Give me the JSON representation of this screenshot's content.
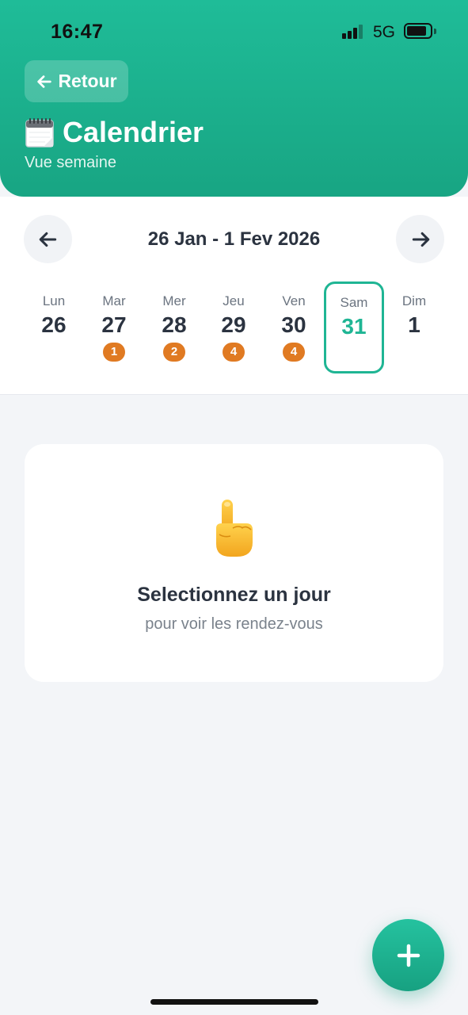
{
  "status_bar": {
    "time": "16:47",
    "network": "5G",
    "icons": [
      "signal-icon",
      "battery-icon"
    ]
  },
  "header": {
    "back_label": "Retour",
    "back_icon": "arrow-left-icon",
    "title": "Calendrier",
    "title_icon": "calendar-icon",
    "subtitle": "Vue semaine"
  },
  "week": {
    "range": "26 Jan - 1 Fev 2026",
    "prev_icon": "arrow-left-icon",
    "next_icon": "arrow-right-icon",
    "days": [
      {
        "name": "Lun",
        "number": "26",
        "badge": ""
      },
      {
        "name": "Mar",
        "number": "27",
        "badge": "1"
      },
      {
        "name": "Mer",
        "number": "28",
        "badge": "2"
      },
      {
        "name": "Jeu",
        "number": "29",
        "badge": "4"
      },
      {
        "name": "Ven",
        "number": "30",
        "badge": "4"
      },
      {
        "name": "Sam",
        "number": "31",
        "badge": ""
      },
      {
        "name": "Dim",
        "number": "1",
        "badge": ""
      }
    ],
    "selected_day_index": 5
  },
  "empty_state": {
    "icon": "pointing-up-hand-icon",
    "title": "Selectionnez un jour",
    "subtitle": "pour voir les rendez-vous"
  },
  "fab": {
    "icon": "plus-icon"
  },
  "colors": {
    "primary": "#1fb594",
    "badge": "#e07a22",
    "text": "#2b3340",
    "background": "#f3f5f8"
  }
}
